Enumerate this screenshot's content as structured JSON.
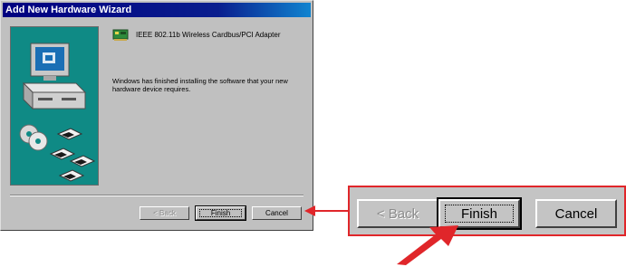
{
  "window": {
    "title": "Add New Hardware Wizard"
  },
  "device": {
    "icon": "network-card-icon",
    "name": "IEEE 802.11b Wireless Cardbus/PCI Adapter"
  },
  "message": "Windows has finished installing the software that your new hardware device requires.",
  "buttons": {
    "back_label": "< Back",
    "finish_label": "Finish",
    "cancel_label": "Cancel",
    "back_enabled": false,
    "default": "finish"
  },
  "zoom": {
    "back_label": "< Back",
    "finish_label": "Finish",
    "cancel_label": "Cancel"
  },
  "colors": {
    "title_bar": "#000080",
    "panel": "#0f8a85",
    "window": "#c0c0c0",
    "highlight": "#e0262a"
  }
}
